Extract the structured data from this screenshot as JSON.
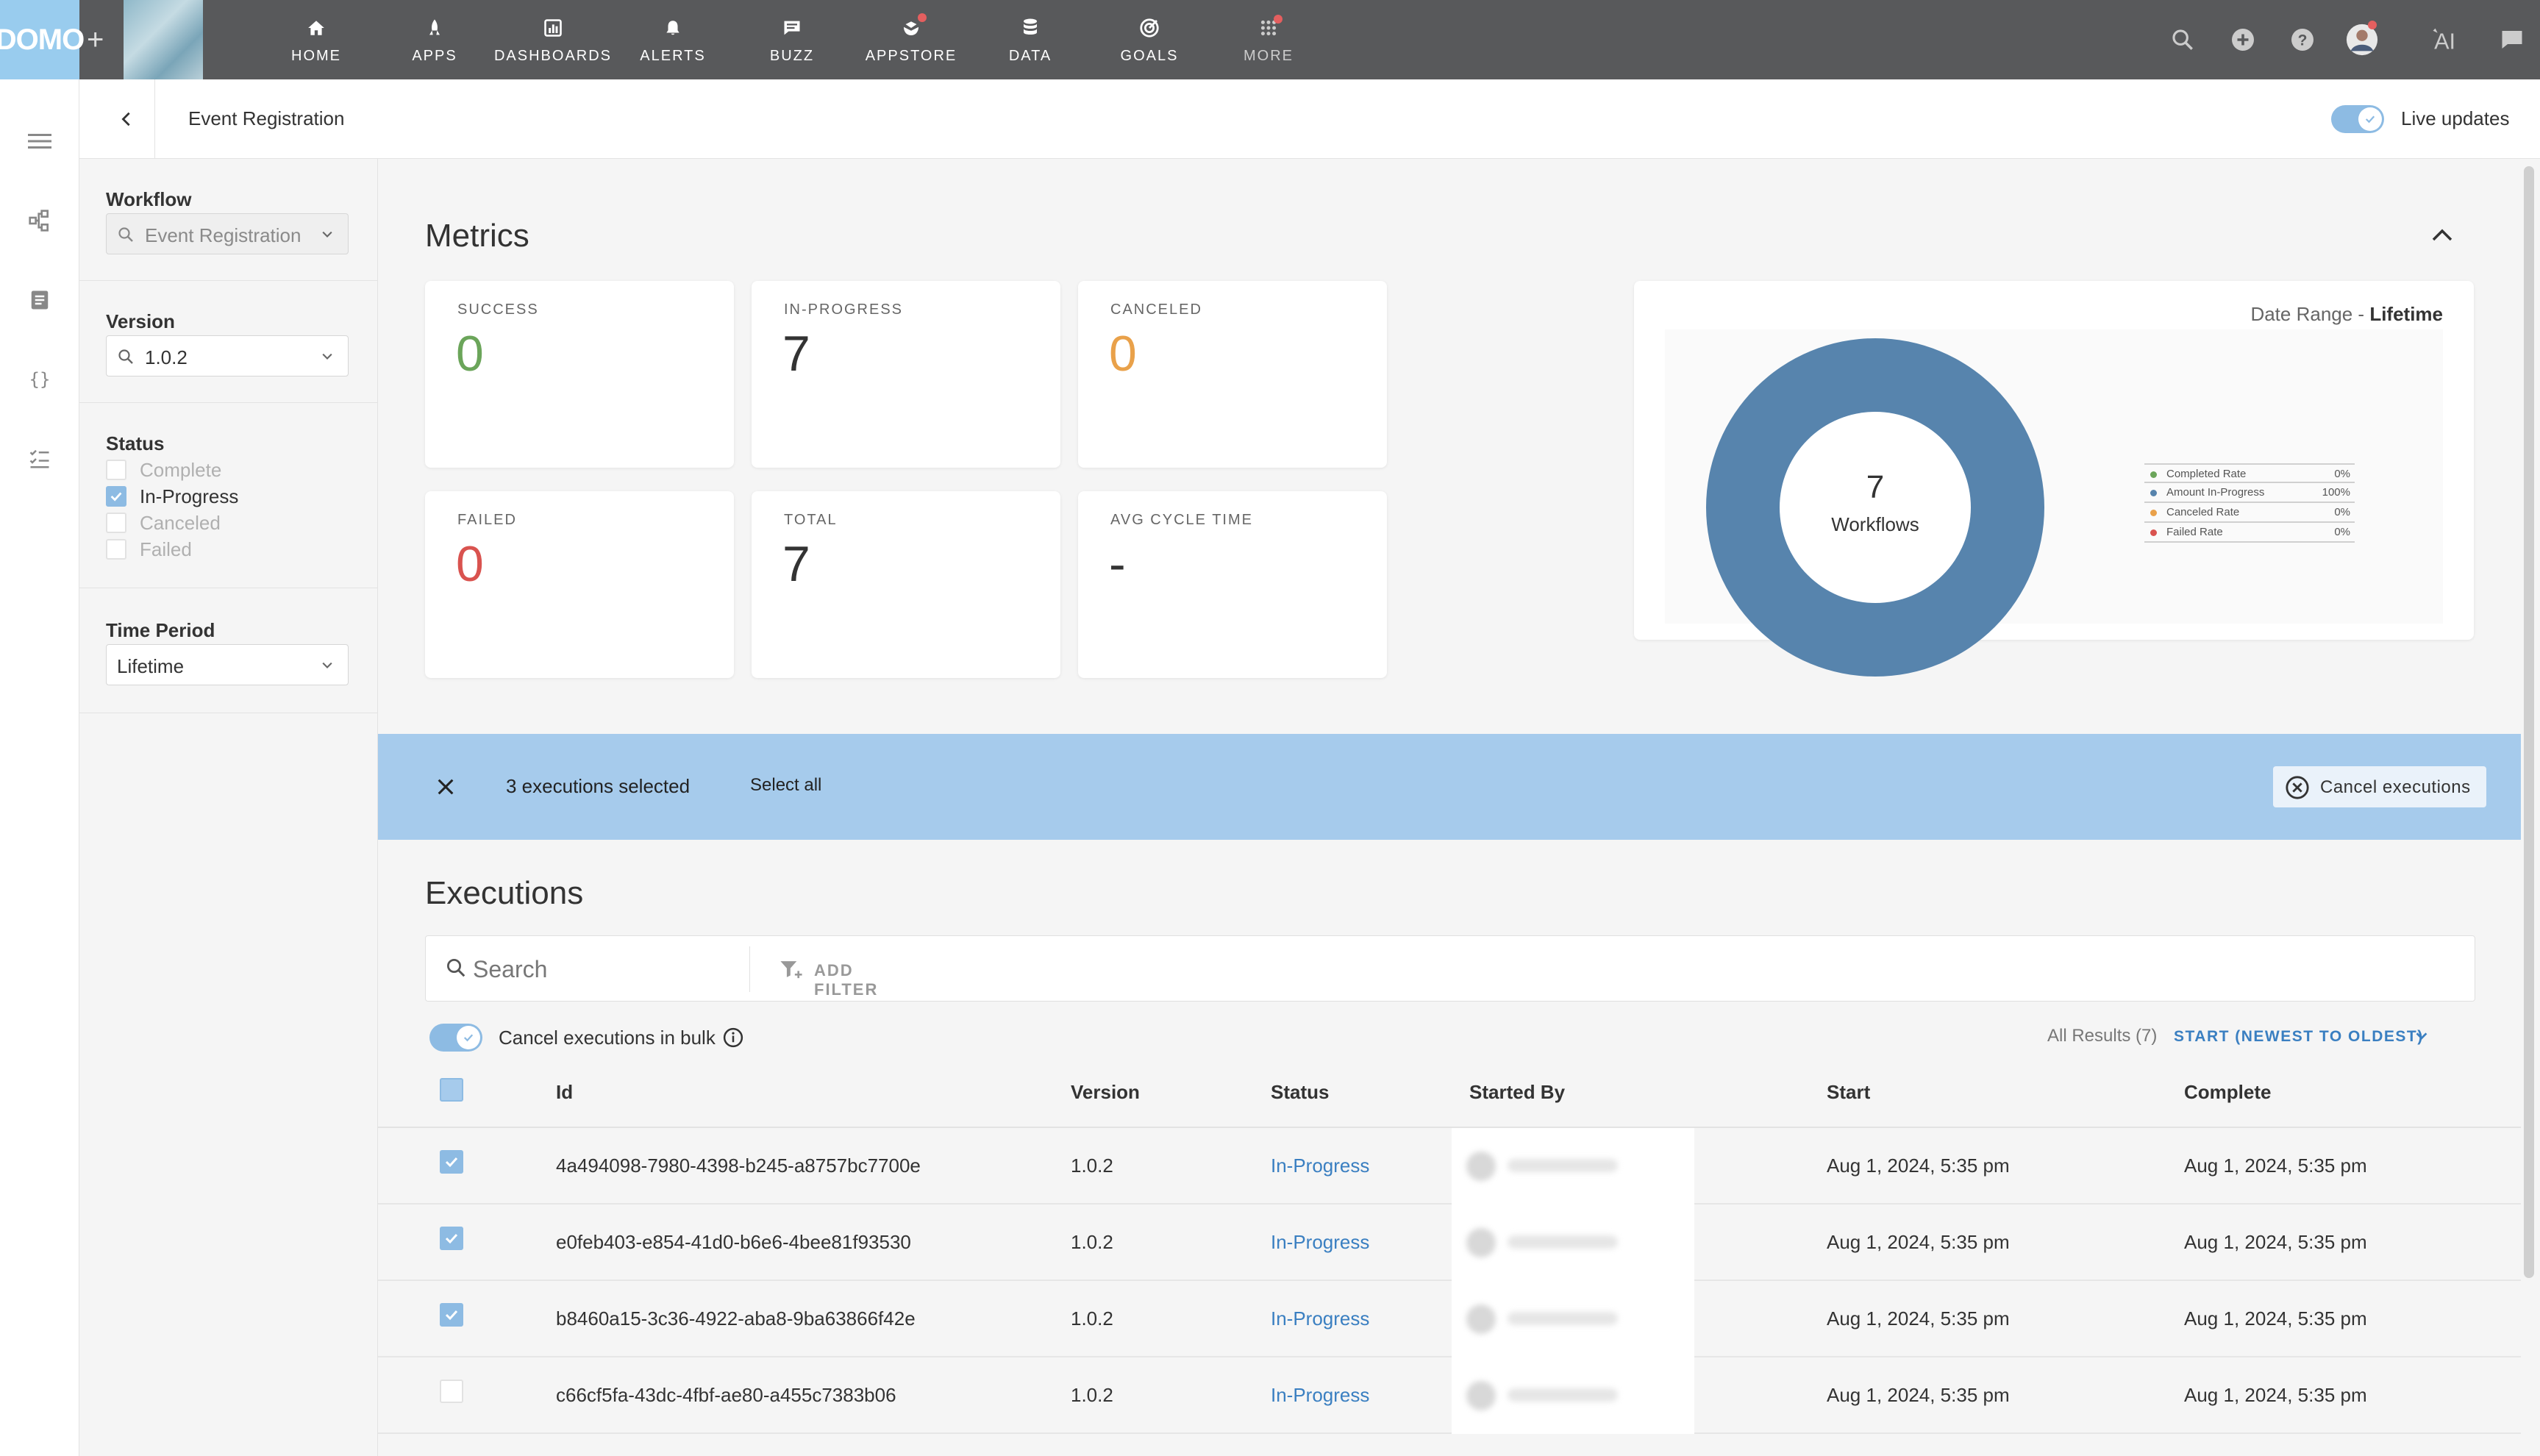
{
  "topnav": {
    "logo": "DOMO",
    "plus": "+",
    "items": [
      {
        "label": "HOME",
        "icon": "home-icon"
      },
      {
        "label": "APPS",
        "icon": "apps-icon"
      },
      {
        "label": "DASHBOARDS",
        "icon": "dashboards-icon"
      },
      {
        "label": "ALERTS",
        "icon": "bell-icon"
      },
      {
        "label": "BUZZ",
        "icon": "chat-icon"
      },
      {
        "label": "APPSTORE",
        "icon": "appstore-icon"
      },
      {
        "label": "DATA",
        "icon": "database-icon"
      },
      {
        "label": "GOALS",
        "icon": "target-icon"
      },
      {
        "label": "MORE",
        "icon": "grid-icon"
      }
    ],
    "accent": "#99ccee",
    "bg": "#58595b"
  },
  "header": {
    "title": "Event Registration",
    "live_updates_label": "Live updates",
    "live_updates_on": true
  },
  "filters": {
    "workflow_label": "Workflow",
    "workflow_value": "Event Registration",
    "version_label": "Version",
    "version_value": "1.0.2",
    "status_label": "Status",
    "statuses": [
      {
        "label": "Complete",
        "checked": false
      },
      {
        "label": "In-Progress",
        "checked": true
      },
      {
        "label": "Canceled",
        "checked": false
      },
      {
        "label": "Failed",
        "checked": false
      }
    ],
    "time_label": "Time Period",
    "time_value": "Lifetime"
  },
  "metrics": {
    "title": "Metrics",
    "cards": [
      {
        "label": "SUCCESS",
        "value": "0",
        "color": "#6ba55a"
      },
      {
        "label": "IN-PROGRESS",
        "value": "7",
        "color": "#333333"
      },
      {
        "label": "CANCELED",
        "value": "0",
        "color": "#e9a14a"
      },
      {
        "label": "FAILED",
        "value": "0",
        "color": "#d9534f"
      },
      {
        "label": "TOTAL",
        "value": "7",
        "color": "#333333"
      },
      {
        "label": "AVG CYCLE TIME",
        "value": "-",
        "color": "#333333"
      }
    ],
    "date_range_prefix": "Date Range - ",
    "date_range_value": "Lifetime"
  },
  "chart_data": {
    "type": "pie",
    "center_value": "7",
    "center_label": "Workflows",
    "categories": [
      "Completed Rate",
      "Amount In-Progress",
      "Canceled Rate",
      "Failed Rate"
    ],
    "values": [
      0,
      100,
      0,
      0
    ],
    "value_labels": [
      "0%",
      "100%",
      "0%",
      "0%"
    ],
    "colors": [
      "#6ba55a",
      "#5784ad",
      "#e9a14a",
      "#d9534f"
    ],
    "legend_position": "right"
  },
  "selection": {
    "count_text": "3 executions selected",
    "select_all": "Select all",
    "cancel_button": "Cancel executions"
  },
  "executions": {
    "title": "Executions",
    "search_placeholder": "Search",
    "add_filter": "ADD FILTER",
    "bulk_label": "Cancel executions in bulk",
    "results": "All Results (7)",
    "sort_label": "START (NEWEST TO OLDEST)",
    "columns": [
      "Id",
      "Version",
      "Status",
      "Started By",
      "Start",
      "Complete"
    ],
    "rows": [
      {
        "checked": true,
        "id": "4a494098-7980-4398-b245-a8757bc7700e",
        "version": "1.0.2",
        "status": "In-Progress",
        "start": "Aug 1, 2024, 5:35 pm",
        "complete": "Aug 1, 2024, 5:35 pm"
      },
      {
        "checked": true,
        "id": "e0feb403-e854-41d0-b6e6-4bee81f93530",
        "version": "1.0.2",
        "status": "In-Progress",
        "start": "Aug 1, 2024, 5:35 pm",
        "complete": "Aug 1, 2024, 5:35 pm"
      },
      {
        "checked": true,
        "id": "b8460a15-3c36-4922-aba8-9ba63866f42e",
        "version": "1.0.2",
        "status": "In-Progress",
        "start": "Aug 1, 2024, 5:35 pm",
        "complete": "Aug 1, 2024, 5:35 pm"
      },
      {
        "checked": false,
        "id": "c66cf5fa-43dc-4fbf-ae80-a455c7383b06",
        "version": "1.0.2",
        "status": "In-Progress",
        "start": "Aug 1, 2024, 5:35 pm",
        "complete": "Aug 1, 2024, 5:35 pm"
      }
    ]
  }
}
